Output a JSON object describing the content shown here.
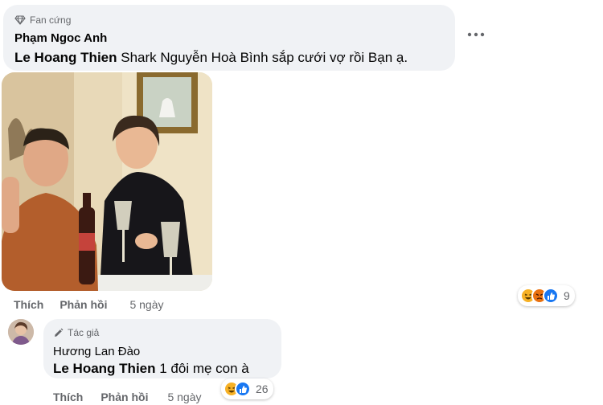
{
  "comment1": {
    "badge": "Fan cứng",
    "author": "Phạm Ngoc Anh",
    "mention": "Le Hoang Thien",
    "text": "Shark Nguyễn Hoà Bình sắp cưới vợ rồi Bạn ạ.",
    "actions": {
      "like": "Thích",
      "reply": "Phản hồi",
      "time": "5 ngày"
    },
    "reactions": {
      "icons": [
        "haha-icon",
        "angry-icon",
        "like-icon"
      ],
      "count": "9"
    }
  },
  "comment2": {
    "badge": "Tác giả",
    "author": "Hương Lan Đào",
    "mention": "Le Hoang Thien",
    "text": "1 đôi mẹ con à",
    "actions": {
      "like": "Thích",
      "reply": "Phản hồi",
      "time": "5 ngày"
    },
    "reactions": {
      "icons": [
        "haha-icon",
        "like-icon"
      ],
      "count": "26"
    }
  },
  "colors": {
    "bubble": "#f0f2f5",
    "secondary_text": "#65676b",
    "like_blue": "#1877f2",
    "haha_yellow": "#f7b125",
    "angry_orange": "#e9710f"
  }
}
